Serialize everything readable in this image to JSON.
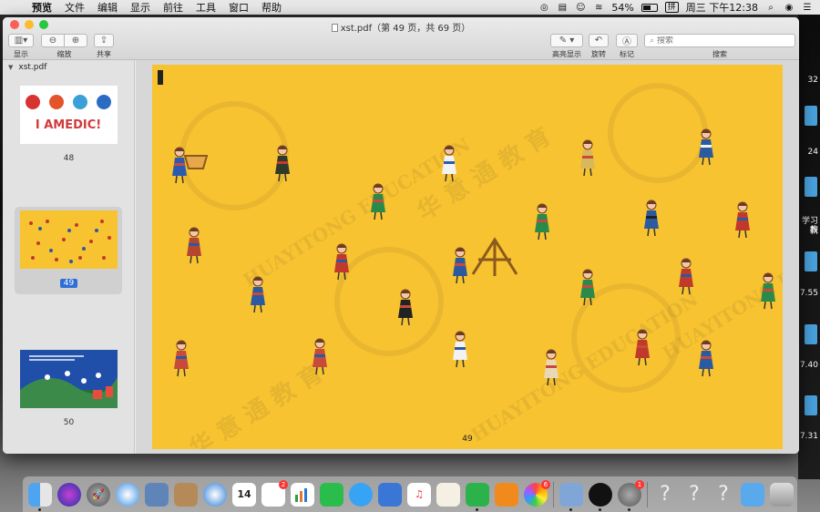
{
  "menubar": {
    "app_name": "预览",
    "items": [
      "文件",
      "编辑",
      "显示",
      "前往",
      "工具",
      "窗口",
      "帮助"
    ],
    "battery_percent": "54%",
    "battery_level": 0.54,
    "input_method": "拼",
    "clock": "周三 下午12:38"
  },
  "window": {
    "title": "xst.pdf（第 49 页，共 69 页）",
    "toolbar": {
      "view_label": "显示",
      "zoom_label": "缩放",
      "share_label": "共享",
      "highlight_label": "高亮显示",
      "rotate_label": "旋转",
      "markup_label": "标记",
      "search_label": "搜索",
      "search_placeholder": "搜索"
    }
  },
  "sidebar": {
    "file_name": "xst.pdf",
    "thumbnails": [
      {
        "page": "48",
        "text": "I AMEDIC!"
      },
      {
        "page": "49"
      },
      {
        "page": "50"
      }
    ]
  },
  "document": {
    "page_number": "49",
    "watermark_cn": "华 意 通 教 育",
    "watermark_en": "HUAYITONG EDUCATION",
    "background": "#f7c331"
  },
  "desktop": {
    "side_labels": [
      "32",
      "24",
      "学习教",
      "新",
      "7.55",
      "7.40",
      "7.31"
    ]
  },
  "dock": {
    "apps": [
      "finder",
      "siri",
      "launchpad",
      "safari",
      "photo-preview",
      "contacts",
      "mail",
      "calendar",
      "reminders",
      "numbers",
      "facetime",
      "messages",
      "keynote",
      "music",
      "news",
      "wechat",
      "books",
      "photos",
      "preview",
      "qq",
      "system-preferences",
      "unknown-1",
      "unknown-2",
      "unknown-3",
      "downloads",
      "trash"
    ],
    "calendar_day": "14",
    "badges": {
      "reminders": "2",
      "photos": "6",
      "system_preferences": "1"
    }
  }
}
